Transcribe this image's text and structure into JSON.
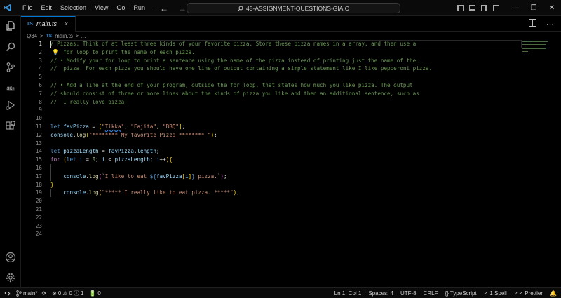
{
  "titlebar": {
    "menu": [
      "File",
      "Edit",
      "Selection",
      "View",
      "Go",
      "Run",
      "⋯"
    ],
    "search_text": "45-ASSIGNMENT-QUESTIONS-GIAIC"
  },
  "activity": {
    "badge": "3K+"
  },
  "tab": {
    "badge": "TS",
    "label": "main.ts",
    "close": "×"
  },
  "breadcrumb": {
    "folder": "Q34",
    "sep": ">",
    "badge": "TS",
    "file": "main.ts",
    "rest": "> …"
  },
  "editor": {
    "line_numbers": [
      "1",
      "2",
      "3",
      "4",
      "5",
      "6",
      "7",
      "8",
      "9",
      "10",
      "11",
      "12",
      "13",
      "14",
      "15",
      "16",
      "17",
      "18",
      "19",
      "20",
      "21",
      "22",
      "23",
      "24"
    ],
    "lines": [
      "/ Pizzas: Think of at least three kinds of your favorite pizza. Store these pizza names in a array, and then use a",
      "    for loop to print the name of each pizza.",
      "// • Modify your for loop to print a sentence using the name of the pizza instead of printing just the name of the",
      "//  pizza. For each pizza you should have one line of output containing a simple statement like I like pepperoni pizza.",
      "",
      "// • Add a line at the end of your program, outside the for loop, that states how much you like pizza. The output",
      "// should consist of three or more lines about the kinds of pizza you like and then an additional sentence, such as",
      "//  I really love pizza!",
      "",
      "",
      "let favPizza = [\"Tikka\", \"Fajita\", \"BBQ\"];",
      "console.log(\"******** My favorite Pizza ******** \");",
      "",
      "let pizzaLength = favPizza.length;",
      "for (let i = 0; i < pizzaLength; i++){",
      "",
      "    console.log(`I like to eat ${favPizza[i]} pizza.`);",
      "}",
      "    console.log(\"***** I really like to eat pizza. *****\");",
      "",
      "",
      "",
      "",
      ""
    ]
  },
  "status": {
    "branch": "main*",
    "problems_errors": "0",
    "problems_warnings": "0",
    "info": "1",
    "ports": "0",
    "position": "Ln 1, Col 1",
    "spaces": "Spaces: 4",
    "encoding": "UTF-8",
    "eol": "CRLF",
    "language": "TypeScript",
    "spell": "1 Spell",
    "formatter": "Prettier"
  }
}
